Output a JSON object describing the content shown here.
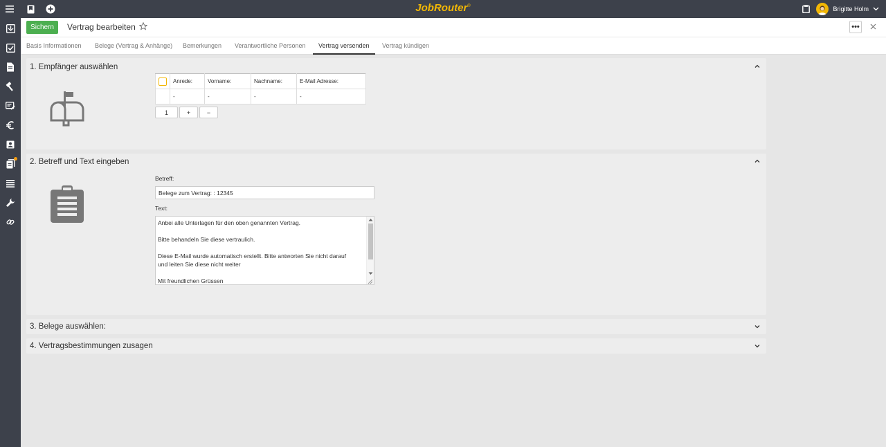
{
  "app": {
    "brand": "JobRouter",
    "brand_mark": "®"
  },
  "topbar": {
    "menu_icon": "menu-icon",
    "bookmark_icon": "bookmark-icon",
    "add_icon": "plus-circle-icon",
    "clipboard_icon": "clipboard-icon"
  },
  "user": {
    "name": "Brigitte Holm"
  },
  "sidebar": {
    "items": [
      {
        "icon": "inbox-icon"
      },
      {
        "icon": "checkbox-icon"
      },
      {
        "icon": "document-icon"
      },
      {
        "icon": "hammer-icon"
      },
      {
        "icon": "forms-icon"
      },
      {
        "icon": "euro-icon"
      },
      {
        "icon": "contact-card-icon"
      },
      {
        "icon": "files-icon",
        "badge": true
      },
      {
        "icon": "list-icon"
      },
      {
        "icon": "wrench-icon"
      },
      {
        "icon": "link-icon"
      }
    ]
  },
  "header": {
    "save_label": "Sichern",
    "title": "Vertrag bearbeiten",
    "more_label": "•••"
  },
  "tabs": [
    {
      "label": "Basis Informationen"
    },
    {
      "label": "Belege (Vertrag & Anhänge)"
    },
    {
      "label": "Bemerkungen"
    },
    {
      "label": "Verantwortliche Personen"
    },
    {
      "label": "Vertrag versenden",
      "active": true
    },
    {
      "label": "Vertrag kündigen"
    }
  ],
  "sections": {
    "recipients": {
      "title": "1. Empfänger auswählen",
      "columns": [
        "Anrede:",
        "Vorname:",
        "Nachname:",
        "E-Mail Adresse:"
      ],
      "row": [
        "-",
        "-",
        "-",
        "-"
      ],
      "count": "1",
      "add_label": "+",
      "remove_label": "−"
    },
    "subject_text": {
      "title": "2. Betreff und Text eingeben",
      "subject_label": "Betreff:",
      "subject_value": "Belege zum Vertrag: : 12345",
      "text_label": "Text:",
      "text_lines": [
        "Anbei alle Unterlagen für den oben genannten Vertrag.",
        "Bitte behandeln Sie diese vertraulich.",
        "Diese E-Mail wurde automatisch erstellt. Bitte antworten Sie nicht darauf",
        "und leiten Sie diese nicht weiter",
        "Mit freundlichen Grüssen"
      ]
    },
    "documents": {
      "title": "3. Belege auswählen:"
    },
    "terms": {
      "title": "4. Vertragsbestimmungen zusagen"
    }
  },
  "colors": {
    "accent": "#f2b705",
    "save": "#4caf50",
    "chrome": "#3d414b"
  }
}
